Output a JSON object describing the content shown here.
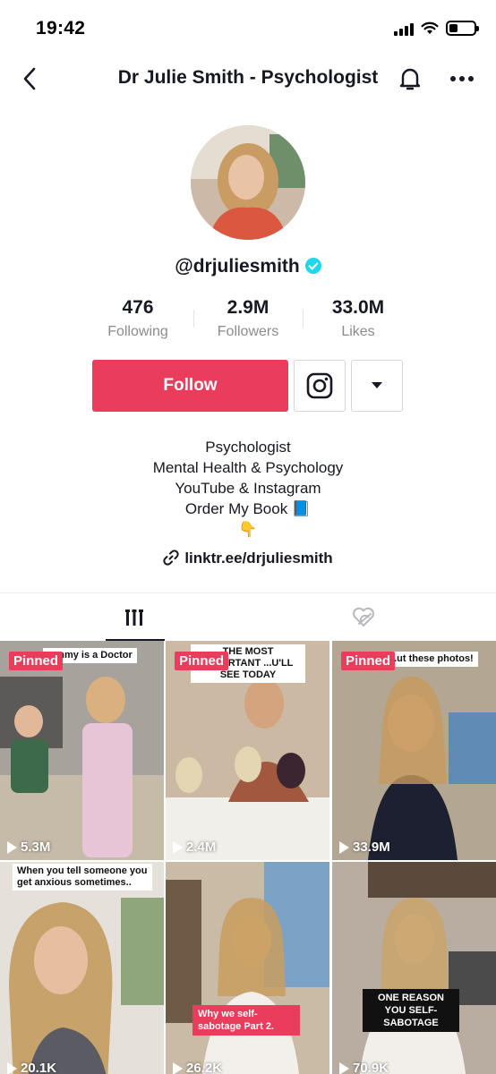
{
  "status_bar": {
    "time": "19:42"
  },
  "header": {
    "title": "Dr Julie Smith - Psychologist"
  },
  "profile": {
    "username": "@drjuliesmith",
    "stats": [
      {
        "value": "476",
        "label": "Following"
      },
      {
        "value": "2.9M",
        "label": "Followers"
      },
      {
        "value": "33.0M",
        "label": "Likes"
      }
    ],
    "follow_label": "Follow",
    "bio": [
      "Psychologist",
      "Mental Health & Psychology",
      "YouTube & Instagram",
      "Order My Book 📘",
      "👇"
    ],
    "link": "linktr.ee/drjuliesmith"
  },
  "videos": [
    {
      "pinned": "Pinned",
      "caption": "...mmy is a Doctor",
      "views": "5.3M"
    },
    {
      "pinned": "Pinned",
      "caption": "THE MOST IMPORTANT ...U'LL SEE TODAY",
      "views": "2.4M"
    },
    {
      "pinned": "Pinned",
      "caption": "...ut these photos!",
      "views": "33.9M"
    },
    {
      "caption": "When you tell someone you get anxious sometimes..",
      "views": "20.1K"
    },
    {
      "caption": "Why we self-sabotage Part 2.",
      "views": "26.2K"
    },
    {
      "caption": "ONE REASON YOU SELF-SABOTAGE",
      "views": "70.9K"
    }
  ],
  "colors": {
    "accent": "#ea3c5b",
    "verified": "#20d5ec",
    "muted_text": "#8a8b91"
  }
}
